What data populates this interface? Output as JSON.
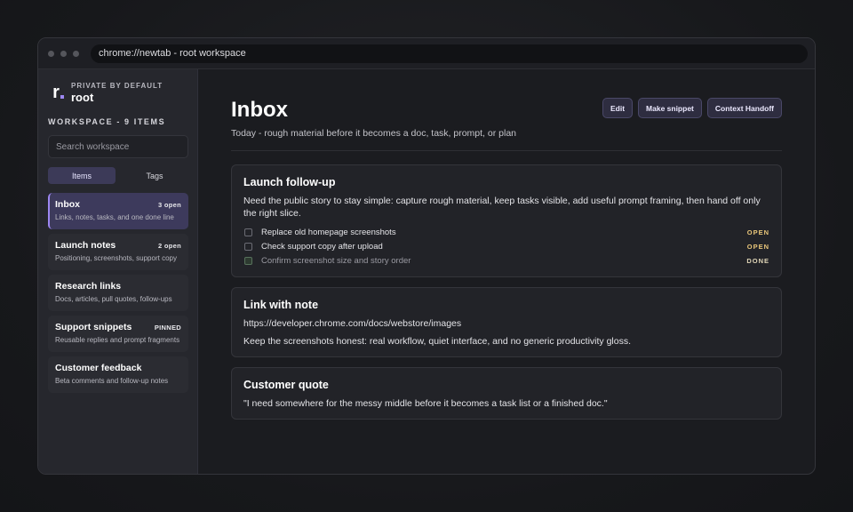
{
  "browser": {
    "url": "chrome://newtab - root workspace"
  },
  "brand": {
    "logo_letter": "r.",
    "kicker": "PRIVATE BY DEFAULT",
    "name": "root"
  },
  "sidebar": {
    "heading": "WORKSPACE - 9 ITEMS",
    "search_placeholder": "Search workspace",
    "tabs": [
      {
        "label": "Items",
        "active": true
      },
      {
        "label": "Tags",
        "active": false
      }
    ],
    "items": [
      {
        "title": "Inbox",
        "badge": "3 open",
        "subtitle": "Links, notes, tasks, and one done line",
        "active": true
      },
      {
        "title": "Launch notes",
        "badge": "2 open",
        "subtitle": "Positioning, screenshots, support copy",
        "active": false
      },
      {
        "title": "Research links",
        "badge": "",
        "subtitle": "Docs, articles, pull quotes, follow-ups",
        "active": false
      },
      {
        "title": "Support snippets",
        "badge": "PINNED",
        "subtitle": "Reusable replies and prompt fragments",
        "active": false
      },
      {
        "title": "Customer feedback",
        "badge": "",
        "subtitle": "Beta comments and follow-up notes",
        "active": false
      }
    ]
  },
  "main": {
    "title": "Inbox",
    "subtitle": "Today - rough material before it becomes a doc, task, prompt, or plan",
    "actions": {
      "edit": "Edit",
      "snippet": "Make snippet",
      "handoff": "Context Handoff"
    },
    "cards": [
      {
        "title": "Launch follow-up",
        "text": "Need the public story to stay simple: capture rough material, keep tasks visible, add useful prompt framing, then hand off only the right slice.",
        "tasks": [
          {
            "label": "Replace old homepage screenshots",
            "status": "OPEN",
            "done": false
          },
          {
            "label": "Check support copy after upload",
            "status": "OPEN",
            "done": false
          },
          {
            "label": "Confirm screenshot size and story order",
            "status": "DONE",
            "done": true
          }
        ]
      },
      {
        "title": "Link with note",
        "link": "https://developer.chrome.com/docs/webstore/images",
        "text": "Keep the screenshots honest: real workflow, quiet interface, and no generic productivity gloss."
      },
      {
        "title": "Customer quote",
        "text": "\"I need somewhere for the messy middle before it becomes a task list or a finished doc.\""
      }
    ]
  }
}
